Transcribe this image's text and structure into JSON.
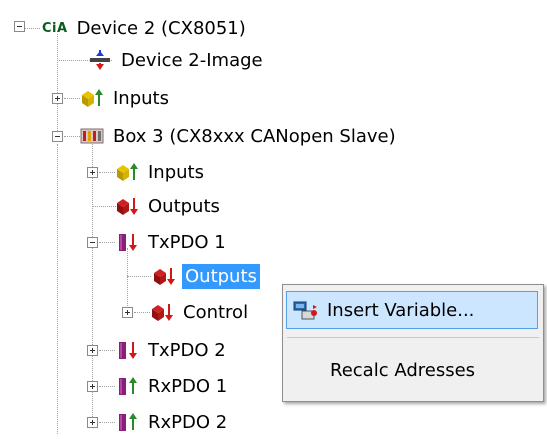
{
  "tree": {
    "root": {
      "badge": "CiA",
      "label": "Device 2 (CX8051)"
    },
    "device_image": {
      "label": "Device 2-Image"
    },
    "device_inputs": {
      "label": "Inputs"
    },
    "box3": {
      "label": "Box 3 (CX8xxx CANopen Slave)"
    },
    "box3_inputs": {
      "label": "Inputs"
    },
    "box3_outputs": {
      "label": "Outputs"
    },
    "txpdo1": {
      "label": "TxPDO 1"
    },
    "txpdo1_outputs": {
      "label": "Outputs"
    },
    "txpdo1_control": {
      "label": "Control"
    },
    "txpdo2": {
      "label": "TxPDO 2"
    },
    "rxpdo1": {
      "label": "RxPDO 1"
    },
    "rxpdo2": {
      "label": "RxPDO 2"
    }
  },
  "context_menu": {
    "items": [
      {
        "label": "Insert Variable...",
        "icon": "insert-variable-icon"
      },
      {
        "label": "Recalc Adresses"
      }
    ]
  },
  "colors": {
    "selection": "#3399ff",
    "menu_hover": "#cde6ff",
    "menu_background": "#f0f0f0"
  }
}
